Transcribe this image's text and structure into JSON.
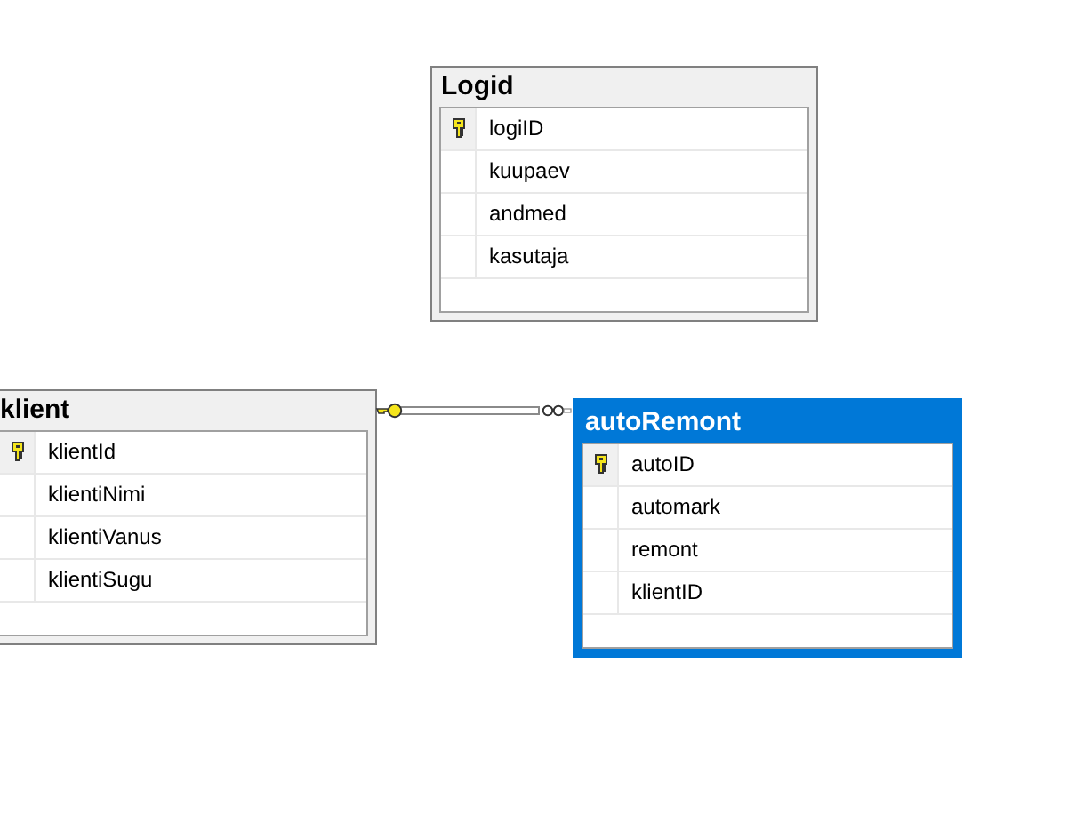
{
  "tables": [
    {
      "name": "Logid",
      "selected": false,
      "columns": [
        {
          "name": "logiID",
          "primary_key": true
        },
        {
          "name": "kuupaev",
          "primary_key": false
        },
        {
          "name": "andmed",
          "primary_key": false
        },
        {
          "name": "kasutaja",
          "primary_key": false
        }
      ]
    },
    {
      "name": "klient",
      "selected": false,
      "columns": [
        {
          "name": "klientId",
          "primary_key": true
        },
        {
          "name": "klientiNimi",
          "primary_key": false
        },
        {
          "name": "klientiVanus",
          "primary_key": false
        },
        {
          "name": "klientiSugu",
          "primary_key": false
        }
      ]
    },
    {
      "name": "autoRemont",
      "selected": true,
      "columns": [
        {
          "name": "autoID",
          "primary_key": true
        },
        {
          "name": "automark",
          "primary_key": false
        },
        {
          "name": "remont",
          "primary_key": false
        },
        {
          "name": "klientID",
          "primary_key": false
        }
      ]
    }
  ]
}
